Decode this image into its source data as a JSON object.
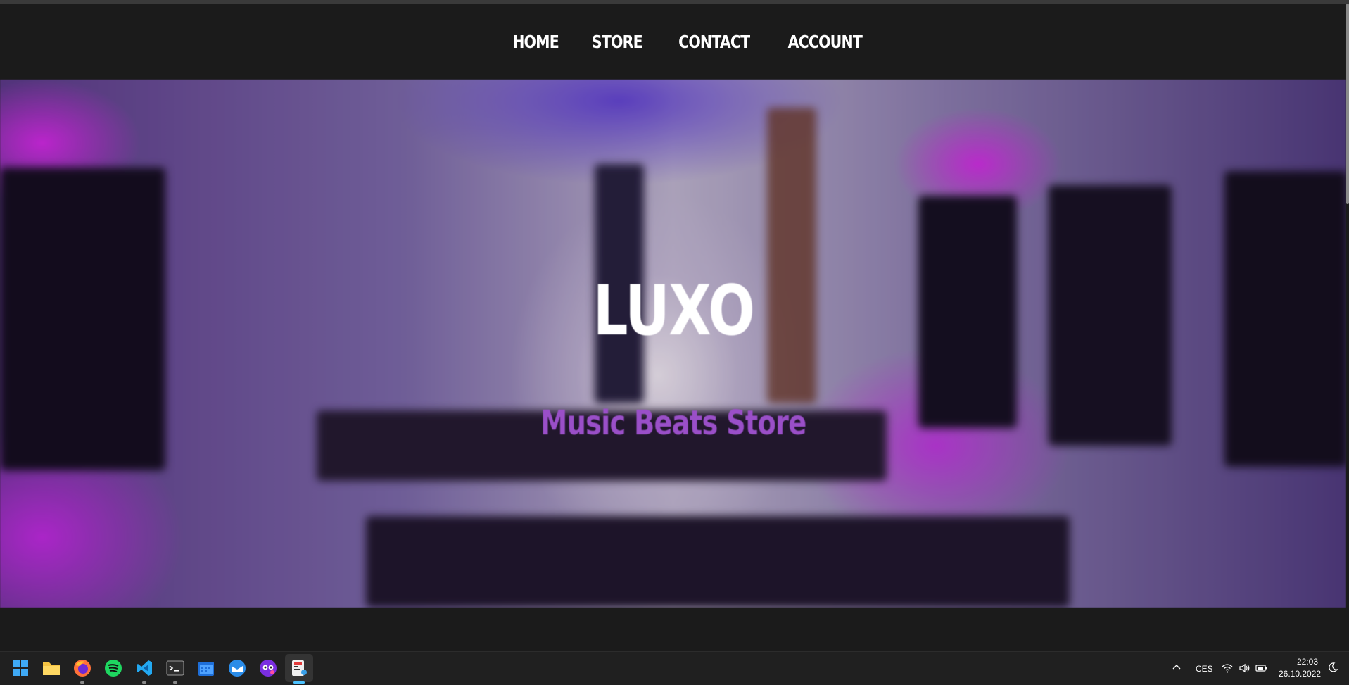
{
  "nav": {
    "items": [
      {
        "label": "HOME"
      },
      {
        "label": "STORE"
      },
      {
        "label": "CONTACT"
      },
      {
        "label": "ACCOUNT"
      }
    ]
  },
  "hero": {
    "title": "LUXO",
    "subtitle": "Music Beats Store",
    "subtitle_color": "#9a4fc8"
  },
  "taskbar": {
    "apps": [
      {
        "name": "start-icon"
      },
      {
        "name": "file-explorer-icon"
      },
      {
        "name": "firefox-icon"
      },
      {
        "name": "spotify-icon"
      },
      {
        "name": "vscode-icon"
      },
      {
        "name": "terminal-icon"
      },
      {
        "name": "calendar-icon"
      },
      {
        "name": "mail-icon"
      },
      {
        "name": "mask-app-icon"
      },
      {
        "name": "paint-app-icon"
      }
    ],
    "tray": {
      "language": "CES",
      "time": "22:03",
      "date": "26.10.2022"
    }
  }
}
